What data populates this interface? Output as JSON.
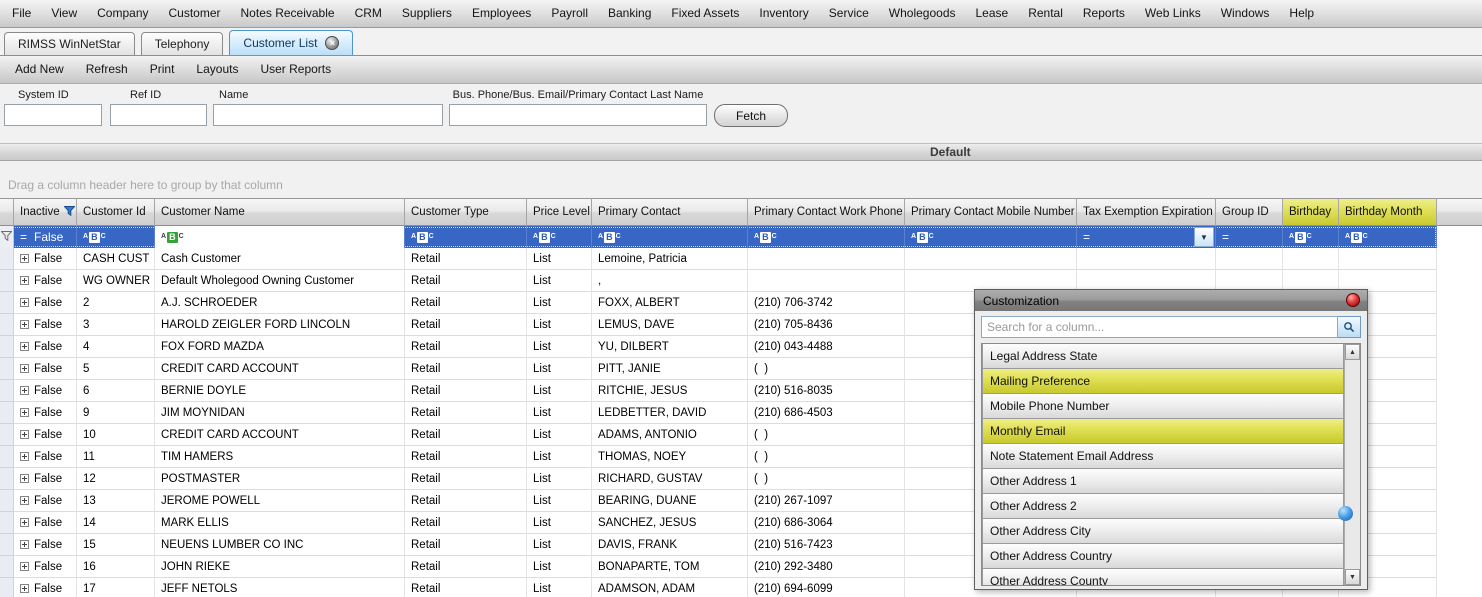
{
  "menu_bar": {
    "items": [
      "File",
      "View",
      "Company",
      "Customer",
      "Notes Receivable",
      "CRM",
      "Suppliers",
      "Employees",
      "Payroll",
      "Banking",
      "Fixed Assets",
      "Inventory",
      "Service",
      "Wholegoods",
      "Lease",
      "Rental",
      "Reports",
      "Web Links",
      "Windows",
      "Help"
    ]
  },
  "tab_bar": {
    "tabs": [
      {
        "label": "RIMSS WinNetStar",
        "active": false,
        "closable": false
      },
      {
        "label": "Telephony",
        "active": false,
        "closable": false
      },
      {
        "label": "Customer List",
        "active": true,
        "closable": true
      }
    ]
  },
  "toolbar": {
    "items": [
      "Add New",
      "Refresh",
      "Print",
      "Layouts",
      "User Reports"
    ]
  },
  "search_panel": {
    "fields": [
      {
        "label": "System ID",
        "value": ""
      },
      {
        "label": "Ref ID",
        "value": ""
      },
      {
        "label": "Name",
        "value": ""
      },
      {
        "label": "Bus. Phone/Bus. Email/Primary Contact Last Name",
        "value": ""
      }
    ],
    "fetch_label": "Fetch"
  },
  "layout_bar": {
    "title": "Default"
  },
  "grid": {
    "group_hint": "Drag a column header here to group by that column",
    "columns": [
      {
        "label": "Inactive",
        "filtered": true,
        "highlight": false
      },
      {
        "label": "Customer Id",
        "filtered": false,
        "highlight": false
      },
      {
        "label": "Customer Name",
        "filtered": false,
        "highlight": false
      },
      {
        "label": "Customer Type",
        "filtered": false,
        "highlight": false
      },
      {
        "label": "Price Level",
        "filtered": false,
        "highlight": false
      },
      {
        "label": "Primary Contact",
        "filtered": false,
        "highlight": false
      },
      {
        "label": "Primary Contact Work Phone",
        "filtered": false,
        "highlight": false
      },
      {
        "label": "Primary Contact Mobile Number",
        "filtered": false,
        "highlight": false
      },
      {
        "label": "Tax Exemption Expiration",
        "filtered": false,
        "highlight": false
      },
      {
        "label": "Group ID",
        "filtered": false,
        "highlight": false
      },
      {
        "label": "Birthday",
        "filtered": false,
        "highlight": true
      },
      {
        "label": "Birthday Month",
        "filtered": false,
        "highlight": true
      }
    ],
    "filter_row": {
      "equals_symbol": "=",
      "inactive_value": "False",
      "cell_types": [
        "equals-text",
        "abc",
        "abc-active",
        "abc",
        "abc",
        "abc",
        "abc",
        "abc",
        "equals-dropdown",
        "equals",
        "abc",
        "abc"
      ]
    },
    "rows": [
      {
        "inactive": "False",
        "customer_id": "CASH CUST",
        "customer_name": "Cash Customer",
        "customer_type": "Retail",
        "price_level": "List",
        "primary_contact": "Lemoine, Patricia",
        "work_phone": "",
        "mobile_number": "",
        "tax_exemption": "",
        "group_id": "",
        "birthday": "",
        "birthday_month": ""
      },
      {
        "inactive": "False",
        "customer_id": "WG OWNER",
        "customer_name": "Default Wholegood Owning Customer",
        "customer_type": "Retail",
        "price_level": "List",
        "primary_contact": ",",
        "work_phone": "",
        "mobile_number": "",
        "tax_exemption": "",
        "group_id": "",
        "birthday": "",
        "birthday_month": ""
      },
      {
        "inactive": "False",
        "customer_id": "2",
        "customer_name": "A.J. SCHROEDER",
        "customer_type": "Retail",
        "price_level": "List",
        "primary_contact": "FOXX, ALBERT",
        "work_phone": "(210) 706-3742",
        "mobile_number": "",
        "tax_exemption": "",
        "group_id": "",
        "birthday": "",
        "birthday_month": ""
      },
      {
        "inactive": "False",
        "customer_id": "3",
        "customer_name": "HAROLD ZEIGLER FORD LINCOLN",
        "customer_type": "Retail",
        "price_level": "List",
        "primary_contact": "LEMUS, DAVE",
        "work_phone": "(210) 705-8436",
        "mobile_number": "",
        "tax_exemption": "",
        "group_id": "",
        "birthday": "",
        "birthday_month": ""
      },
      {
        "inactive": "False",
        "customer_id": "4",
        "customer_name": "FOX FORD MAZDA",
        "customer_type": "Retail",
        "price_level": "List",
        "primary_contact": "YU, DILBERT",
        "work_phone": "(210) 043-4488",
        "mobile_number": "",
        "tax_exemption": "",
        "group_id": "",
        "birthday": "",
        "birthday_month": ""
      },
      {
        "inactive": "False",
        "customer_id": "5",
        "customer_name": "CREDIT CARD ACCOUNT",
        "customer_type": "Retail",
        "price_level": "List",
        "primary_contact": "PITT, JANIE",
        "work_phone": "(  )",
        "mobile_number": "",
        "tax_exemption": "",
        "group_id": "",
        "birthday": "",
        "birthday_month": ""
      },
      {
        "inactive": "False",
        "customer_id": "6",
        "customer_name": "BERNIE DOYLE",
        "customer_type": "Retail",
        "price_level": "List",
        "primary_contact": "RITCHIE, JESUS",
        "work_phone": "(210) 516-8035",
        "mobile_number": "",
        "tax_exemption": "",
        "group_id": "",
        "birthday": "",
        "birthday_month": ""
      },
      {
        "inactive": "False",
        "customer_id": "9",
        "customer_name": "JIM MOYNIDAN",
        "customer_type": "Retail",
        "price_level": "List",
        "primary_contact": "LEDBETTER, DAVID",
        "work_phone": "(210) 686-4503",
        "mobile_number": "",
        "tax_exemption": "",
        "group_id": "",
        "birthday": "",
        "birthday_month": ""
      },
      {
        "inactive": "False",
        "customer_id": "10",
        "customer_name": "CREDIT CARD ACCOUNT",
        "customer_type": "Retail",
        "price_level": "List",
        "primary_contact": "ADAMS, ANTONIO",
        "work_phone": "(  )",
        "mobile_number": "",
        "tax_exemption": "",
        "group_id": "",
        "birthday": "",
        "birthday_month": ""
      },
      {
        "inactive": "False",
        "customer_id": "11",
        "customer_name": "TIM HAMERS",
        "customer_type": "Retail",
        "price_level": "List",
        "primary_contact": "THOMAS, NOEY",
        "work_phone": "(  )",
        "mobile_number": "",
        "tax_exemption": "",
        "group_id": "",
        "birthday": "",
        "birthday_month": ""
      },
      {
        "inactive": "False",
        "customer_id": "12",
        "customer_name": "POSTMASTER",
        "customer_type": "Retail",
        "price_level": "List",
        "primary_contact": "RICHARD, GUSTAV",
        "work_phone": "(  )",
        "mobile_number": "",
        "tax_exemption": "",
        "group_id": "",
        "birthday": "",
        "birthday_month": ""
      },
      {
        "inactive": "False",
        "customer_id": "13",
        "customer_name": "JEROME POWELL",
        "customer_type": "Retail",
        "price_level": "List",
        "primary_contact": "BEARING, DUANE",
        "work_phone": "(210) 267-1097",
        "mobile_number": "",
        "tax_exemption": "",
        "group_id": "",
        "birthday": "",
        "birthday_month": ""
      },
      {
        "inactive": "False",
        "customer_id": "14",
        "customer_name": "MARK ELLIS",
        "customer_type": "Retail",
        "price_level": "List",
        "primary_contact": "SANCHEZ, JESUS",
        "work_phone": "(210) 686-3064",
        "mobile_number": "",
        "tax_exemption": "",
        "group_id": "",
        "birthday": "",
        "birthday_month": ""
      },
      {
        "inactive": "False",
        "customer_id": "15",
        "customer_name": "NEUENS LUMBER CO INC",
        "customer_type": "Retail",
        "price_level": "List",
        "primary_contact": "DAVIS, FRANK",
        "work_phone": "(210) 516-7423",
        "mobile_number": "",
        "tax_exemption": "",
        "group_id": "",
        "birthday": "",
        "birthday_month": ""
      },
      {
        "inactive": "False",
        "customer_id": "16",
        "customer_name": "JOHN RIEKE",
        "customer_type": "Retail",
        "price_level": "List",
        "primary_contact": "BONAPARTE, TOM",
        "work_phone": "(210) 292-3480",
        "mobile_number": "",
        "tax_exemption": "",
        "group_id": "",
        "birthday": "",
        "birthday_month": ""
      },
      {
        "inactive": "False",
        "customer_id": "17",
        "customer_name": "JEFF NETOLS",
        "customer_type": "Retail",
        "price_level": "List",
        "primary_contact": "ADAMSON, ADAM",
        "work_phone": "(210) 694-6099",
        "mobile_number": "",
        "tax_exemption": "",
        "group_id": "",
        "birthday": "",
        "birthday_month": ""
      }
    ]
  },
  "customization": {
    "title": "Customization",
    "search_placeholder": "Search for a column...",
    "items": [
      {
        "label": "Legal Address State",
        "highlight": false
      },
      {
        "label": "Mailing Preference",
        "highlight": true
      },
      {
        "label": "Mobile Phone Number",
        "highlight": false
      },
      {
        "label": "Monthly Email",
        "highlight": true
      },
      {
        "label": "Note Statement Email Address",
        "highlight": false
      },
      {
        "label": "Other Address 1",
        "highlight": false
      },
      {
        "label": "Other Address 2",
        "highlight": false
      },
      {
        "label": "Other Address City",
        "highlight": false
      },
      {
        "label": "Other Address Country",
        "highlight": false
      },
      {
        "label": "Other Address County",
        "highlight": false
      }
    ]
  },
  "icons": {
    "close_glyph": "×",
    "text_filter_letters": [
      "A",
      "B",
      "C"
    ],
    "dropdown_arrow": "▼",
    "scroll_up_arrow": "▲",
    "scroll_down_arrow": "▼"
  },
  "colors": {
    "filter_row_blue": "#3766C5",
    "highlight_yellow": "#DEDE52",
    "active_tab_border": "#4E94CF",
    "close_button_red": "#E23B3B"
  }
}
